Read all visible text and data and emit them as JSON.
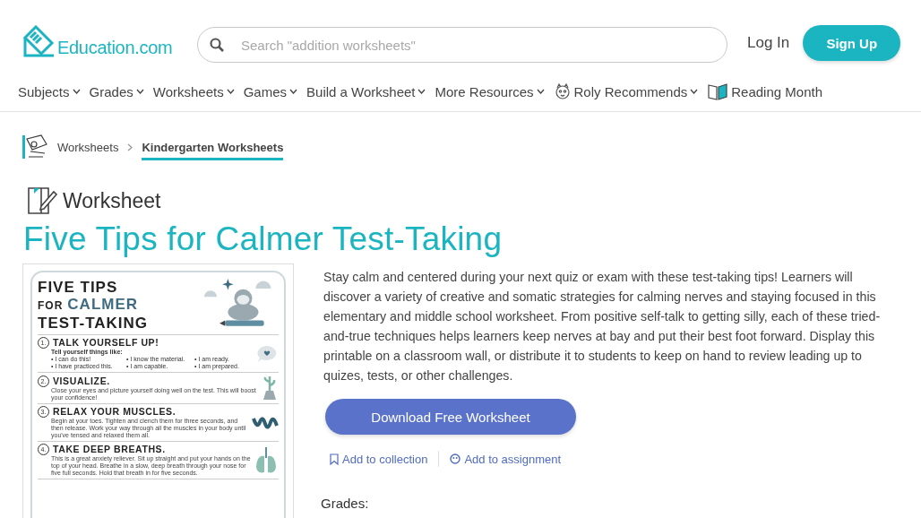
{
  "header": {
    "logo": "Education.com",
    "search": {
      "placeholder": "Search \"addition worksheets\""
    },
    "login": "Log In",
    "signup": "Sign Up"
  },
  "nav": [
    {
      "label": "Subjects",
      "kind": "plain",
      "has_menu": true
    },
    {
      "label": "Grades",
      "kind": "plain",
      "has_menu": true
    },
    {
      "label": "Worksheets",
      "kind": "plain",
      "has_menu": true
    },
    {
      "label": "Games",
      "kind": "plain",
      "has_menu": true
    },
    {
      "label": "Build a Worksheet",
      "kind": "plain",
      "has_menu": true
    },
    {
      "label": "More Resources",
      "kind": "plain",
      "has_menu": true
    },
    {
      "label": "Roly Recommends",
      "kind": "mascot",
      "has_menu": true
    },
    {
      "label": "Reading Month",
      "kind": "book",
      "has_menu": false
    }
  ],
  "breadcrumb": [
    {
      "label": "Worksheets",
      "selected": false
    },
    {
      "label": "Kindergarten Worksheets",
      "selected": true
    }
  ],
  "resource_type": "Worksheet",
  "title": "Five Tips for Calmer Test-Taking",
  "preview": {
    "title_lines": [
      [
        {
          "text": "FIVE TIPS",
          "accent": false,
          "small": false
        }
      ],
      [
        {
          "text": "FOR",
          "accent": false,
          "small": true
        },
        {
          "text": "CALMER",
          "accent": true,
          "small": false
        }
      ],
      [
        {
          "text": "TEST-TAKING",
          "accent": false,
          "small": false
        }
      ]
    ],
    "tips": [
      {
        "number": "1.",
        "heading": "TALK YOURSELF UP!",
        "kind": "talk",
        "intro": "Tell yourself things like:",
        "bullets": [
          "• I can do this!",
          "• I know the material.",
          "• I am ready.",
          "• I have practiced this.",
          "• I am capable.",
          "• I am prepared."
        ]
      },
      {
        "number": "2.",
        "heading": "VISUALIZE.",
        "kind": "plant",
        "body": "Close your eyes and picture yourself doing well on the test. This will boost your confidence!"
      },
      {
        "number": "3.",
        "heading": "RELAX YOUR MUSCLES.",
        "kind": "squiggle",
        "body": "Begin at your toes. Tighten and clench them for three seconds, and then release. Work your way through all the muscles in your body until you've tensed and relaxed them all."
      },
      {
        "number": "4.",
        "heading": "TAKE DEEP BREATHS.",
        "kind": "lungs",
        "body": "This is a great anxiety reliever. Sit up straight and put your hands on the top of your head. Breathe in a slow, deep breath through your nose for five full seconds. Hold that breath in for five seconds."
      }
    ]
  },
  "description": "Stay calm and centered during your next quiz or exam with these test-taking tips! Learners will discover a variety of creative and somatic strategies for calming nerves and staying focused in this elementary and middle school worksheet. From positive self-talk to getting silly, each of these tried-and-true techniques helps learners keep nerves at bay and put their best foot forward. Display this printable on a classroom wall, or distribute it to students to keep on hand to review leading up to quizes, tests, or other challenges.",
  "download": "Download Free Worksheet",
  "actions": [
    {
      "label": "Add to collection",
      "kind": "bookmark"
    },
    {
      "label": "Add to assignment",
      "kind": "assign"
    }
  ],
  "grades_label": "Grades:"
}
